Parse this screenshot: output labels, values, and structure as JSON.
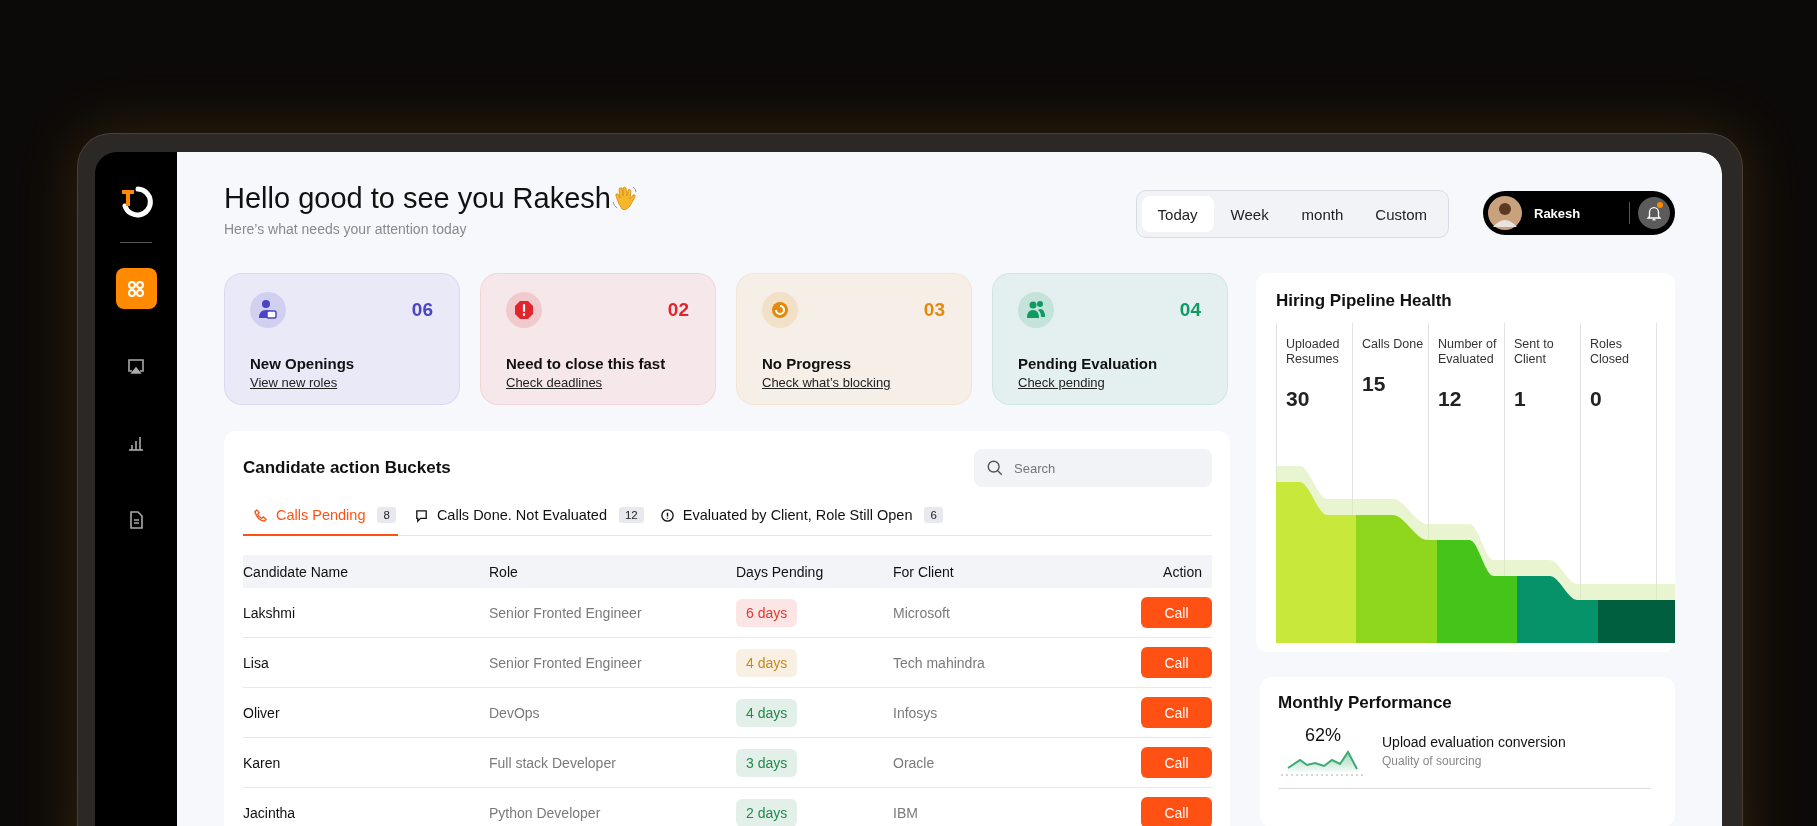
{
  "sidebar": {
    "items": [
      {
        "kind": "dashboard",
        "selected": true
      },
      {
        "kind": "screen",
        "selected": false
      },
      {
        "kind": "reports",
        "selected": false
      },
      {
        "kind": "document",
        "selected": false
      }
    ]
  },
  "header": {
    "greeting": "Hello good to see you Rakesh",
    "subtitle": "Here’s what needs your attention today"
  },
  "period_tabs": [
    {
      "label": "Today",
      "selected": true
    },
    {
      "label": "Week",
      "selected": false
    },
    {
      "label": "month",
      "selected": false
    },
    {
      "label": "Custom",
      "selected": false
    }
  ],
  "profile": {
    "name": "Rakesh",
    "notification": true
  },
  "summary_cards": [
    {
      "kind": "openings",
      "count": "06",
      "title": "New Openings",
      "link": "View new roles",
      "color": "#4a44c6"
    },
    {
      "kind": "urgent",
      "count": "02",
      "title": "Need to close this fast",
      "link": "Check deadlines",
      "color": "#e0262c"
    },
    {
      "kind": "stalled",
      "count": "03",
      "title": "No Progress",
      "link": "Check what’s blocking",
      "color": "#e38a0c"
    },
    {
      "kind": "evaluation",
      "count": "04",
      "title": "Pending Evaluation",
      "link": "Check pending",
      "color": "#0f9a63"
    }
  ],
  "buckets": {
    "title": "Candidate action Buckets",
    "search": {
      "placeholder": "Search"
    },
    "tabs": [
      {
        "kind": "phone",
        "label": "Calls Pending",
        "count": "8",
        "selected": true
      },
      {
        "kind": "chat",
        "label": "Calls Done. Not Evaluated",
        "count": "12",
        "selected": false
      },
      {
        "kind": "alert",
        "label": "Evaluated by Client, Role Still Open",
        "count": "6",
        "selected": false
      }
    ],
    "table": {
      "columns": [
        "Candidate Name",
        "Role",
        "Days Pending",
        "For Client",
        "Action"
      ],
      "rows": [
        {
          "name": "Lakshmi",
          "role": "Senior Fronted Engineer",
          "days": "6 days",
          "color": "#e03a2f",
          "client": "Microsoft",
          "action": "Call"
        },
        {
          "name": "Lisa",
          "role": "Senior Fronted Engineer",
          "days": "4 days",
          "color": "#c98a1b",
          "client": "Tech mahindra",
          "action": "Call"
        },
        {
          "name": "Oliver",
          "role": "DevOps",
          "days": "4 days",
          "color": "#1f8a4c",
          "client": "Infosys",
          "action": "Call"
        },
        {
          "name": "Karen",
          "role": "Full stack Developer",
          "days": "3 days",
          "color": "#1f8a4c",
          "client": "Oracle",
          "action": "Call"
        },
        {
          "name": "Jacintha",
          "role": "Python Developer",
          "days": "2 days",
          "color": "#1f8a4c",
          "client": "IBM",
          "action": "Call"
        }
      ]
    }
  },
  "pipeline": {
    "title": "Hiring Pipeline Health",
    "stages": [
      {
        "label": "Uploaded Resumes",
        "value": "30"
      },
      {
        "label": "Calls Done",
        "value": "15"
      },
      {
        "label": "Number of Evaluated",
        "value": "12"
      },
      {
        "label": "Sent to Client",
        "value": "1"
      },
      {
        "label": "Roles Closed",
        "value": "0"
      }
    ]
  },
  "monthly": {
    "title": "Monthly Performance",
    "metrics": [
      {
        "value": "62%",
        "label": "Upload evaluation conversion",
        "caption": "Quality of sourcing"
      }
    ]
  }
}
